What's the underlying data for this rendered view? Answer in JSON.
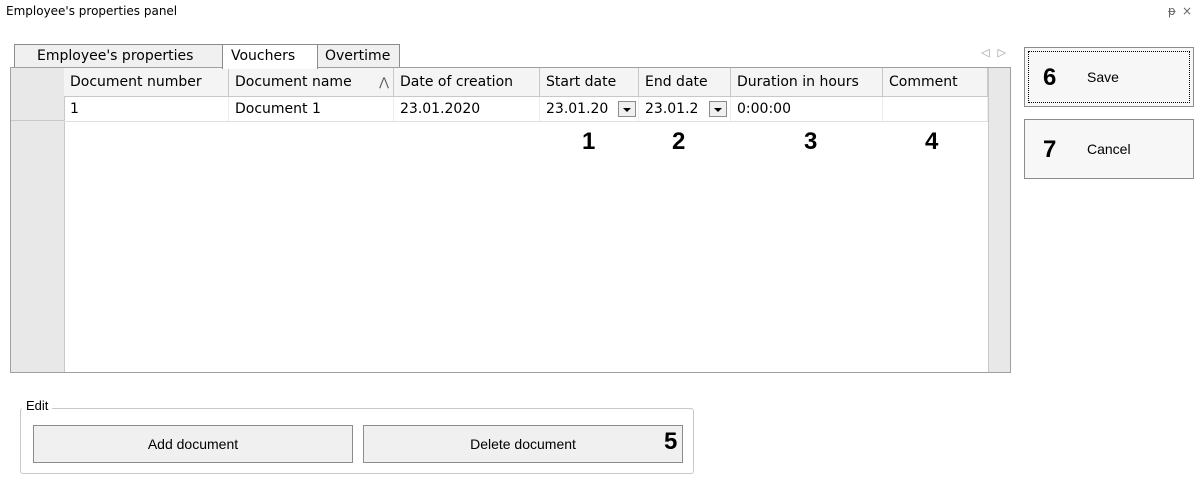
{
  "panel": {
    "title": "Employee's properties panel",
    "pin_icon": "pin-icon",
    "close_icon": "close-icon"
  },
  "tabs": [
    {
      "label": "Employee's properties",
      "active": false
    },
    {
      "label": "Vouchers",
      "active": true
    },
    {
      "label": "Overtime",
      "active": false
    }
  ],
  "grid": {
    "columns": [
      "Document number",
      "Document name",
      "Date of creation",
      "Start date",
      "End date",
      "Duration in hours",
      "Comment"
    ],
    "sort_column": "Document name",
    "rows": [
      {
        "number": "1",
        "name": "Document 1",
        "created": "23.01.2020",
        "start": "23.01.20",
        "end": "23.01.2",
        "duration": "0:00:00",
        "comment": ""
      }
    ]
  },
  "markers": [
    "1",
    "2",
    "3",
    "4",
    "5",
    "6",
    "7"
  ],
  "edit": {
    "group_label": "Edit",
    "add_label": "Add document",
    "delete_label": "Delete document"
  },
  "actions": {
    "save_label": "Save",
    "cancel_label": "Cancel"
  }
}
